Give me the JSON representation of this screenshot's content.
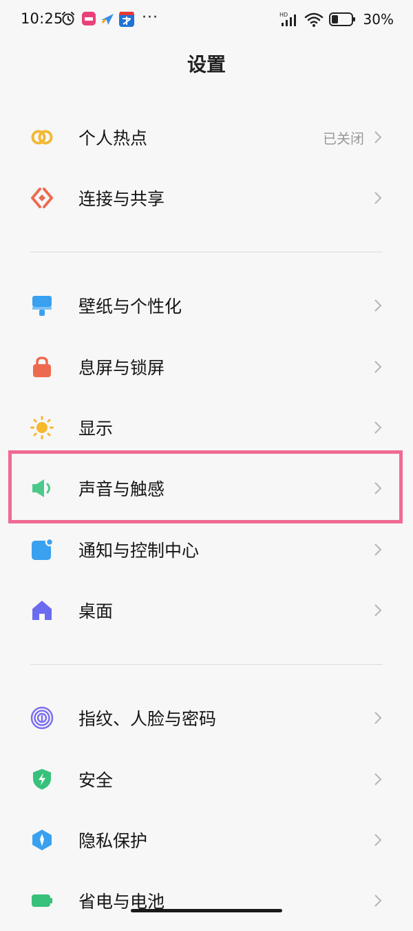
{
  "status_bar": {
    "time": "10:25",
    "more": "···",
    "network_badge": "HD",
    "battery": "30%"
  },
  "header": {
    "title": "设置"
  },
  "sections": [
    {
      "items": [
        {
          "label": "个人热点",
          "value": "已关闭",
          "icon": "hotspot-icon"
        },
        {
          "label": "连接与共享",
          "icon": "connection-sharing-icon"
        }
      ]
    },
    {
      "items": [
        {
          "label": "壁纸与个性化",
          "icon": "wallpaper-icon"
        },
        {
          "label": "息屏与锁屏",
          "icon": "lock-icon"
        },
        {
          "label": "显示",
          "icon": "sun-icon"
        },
        {
          "label": "声音与触感",
          "icon": "speaker-icon",
          "highlighted": true
        },
        {
          "label": "通知与控制中心",
          "icon": "notification-icon"
        },
        {
          "label": "桌面",
          "icon": "home-icon"
        }
      ]
    },
    {
      "items": [
        {
          "label": "指纹、人脸与密码",
          "icon": "fingerprint-icon"
        },
        {
          "label": "安全",
          "icon": "shield-icon"
        },
        {
          "label": "隐私保护",
          "icon": "privacy-icon"
        },
        {
          "label": "省电与电池",
          "icon": "battery-icon"
        }
      ]
    }
  ],
  "colors": {
    "highlight_border": "#ef6b93",
    "background": "#f7f7f7"
  }
}
